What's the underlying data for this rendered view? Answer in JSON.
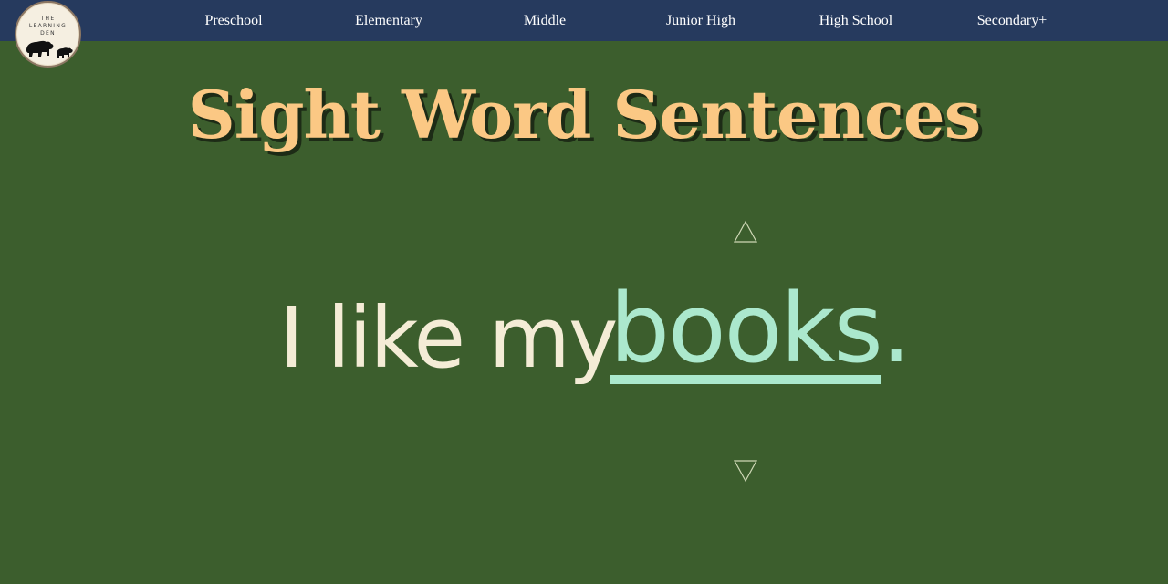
{
  "nav": {
    "logo": {
      "line1": "THE",
      "line2": "LEARNING",
      "line3": "DEN",
      "icon": "bears-logo-icon"
    },
    "items": [
      {
        "label": "Preschool"
      },
      {
        "label": "Elementary"
      },
      {
        "label": "Middle"
      },
      {
        "label": "Junior High"
      },
      {
        "label": "High School"
      },
      {
        "label": "Secondary+"
      }
    ]
  },
  "page": {
    "title": "Sight Word Sentences"
  },
  "sentence": {
    "prefix": "I like my",
    "sight_word": "books."
  },
  "controls": {
    "up_icon": "triangle-up-icon",
    "down_icon": "triangle-down-icon"
  },
  "colors": {
    "background": "#3c5e2d",
    "navbar": "#263a5e",
    "title": "#fbc884",
    "sentence_text": "#f4ecd6",
    "sight_word": "#abe8cd"
  }
}
